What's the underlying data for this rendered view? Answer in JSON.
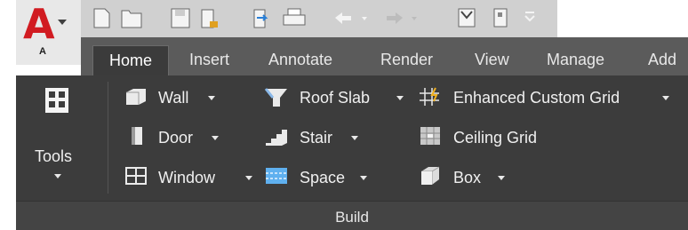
{
  "app": {
    "letter": "A",
    "sub": "A"
  },
  "tabs": [
    "Home",
    "Insert",
    "Annotate",
    "Render",
    "View",
    "Manage",
    "Add"
  ],
  "panel": {
    "title": "Build",
    "tools_label": "Tools",
    "items": {
      "wall": "Wall",
      "door": "Door",
      "window": "Window",
      "roof_slab": "Roof Slab",
      "stair": "Stair",
      "space": "Space",
      "enhanced_custom_grid": "Enhanced Custom Grid",
      "ceiling_grid": "Ceiling Grid",
      "box": "Box"
    }
  },
  "colors": {
    "accent": "#d11b21",
    "ribbon_bg": "#3c3c3c",
    "tabbar_bg": "#5b5b5b",
    "qat_bg": "#d0d0d0"
  }
}
